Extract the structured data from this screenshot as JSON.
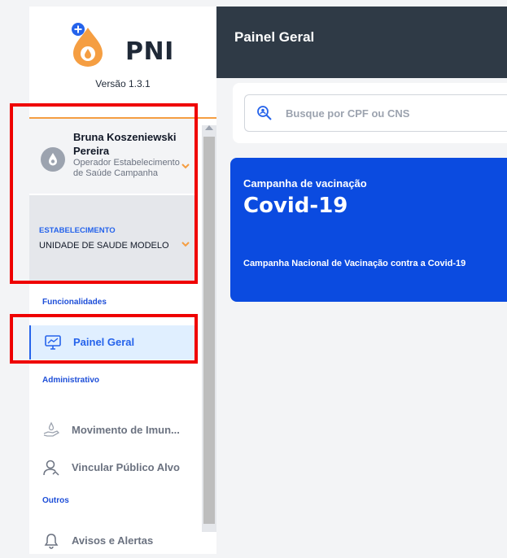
{
  "app": {
    "logo_text": "PNI",
    "version": "Versão 1.3.1"
  },
  "user": {
    "name": "Bruna Koszeniewski Pereira",
    "role": "Operador Estabelecimento de Saúde Campanha"
  },
  "establishment": {
    "label": "ESTABELECIMENTO",
    "value": "UNIDADE DE SAUDE MODELO"
  },
  "sidebar": {
    "sections": [
      {
        "title": "Funcionalidades",
        "items": [
          {
            "label": "Painel Geral",
            "icon": "monitor-chart-icon",
            "active": true
          }
        ]
      },
      {
        "title": "Administrativo",
        "items": [
          {
            "label": "Movimento de Imunobiológicos",
            "label_display": "Movimento de Imun...",
            "icon": "hand-drop-icon"
          },
          {
            "label": "Vincular Público Alvo",
            "icon": "user-link-icon"
          }
        ]
      },
      {
        "title": "Outros",
        "items": [
          {
            "label": "Avisos e Alertas",
            "icon": "bell-icon"
          }
        ]
      }
    ]
  },
  "header": {
    "title": "Painel Geral"
  },
  "search": {
    "placeholder": "Busque por CPF ou CNS"
  },
  "campaign": {
    "kicker": "Campanha de vacinação",
    "title": "Covid-19",
    "description": "Campanha Nacional de Vacinação contra a Covid-19"
  },
  "colors": {
    "accent_blue": "#0b4be0",
    "header_bg": "#2f3a46",
    "logo_orange": "#f59e42",
    "highlight_red": "#ef0000"
  }
}
